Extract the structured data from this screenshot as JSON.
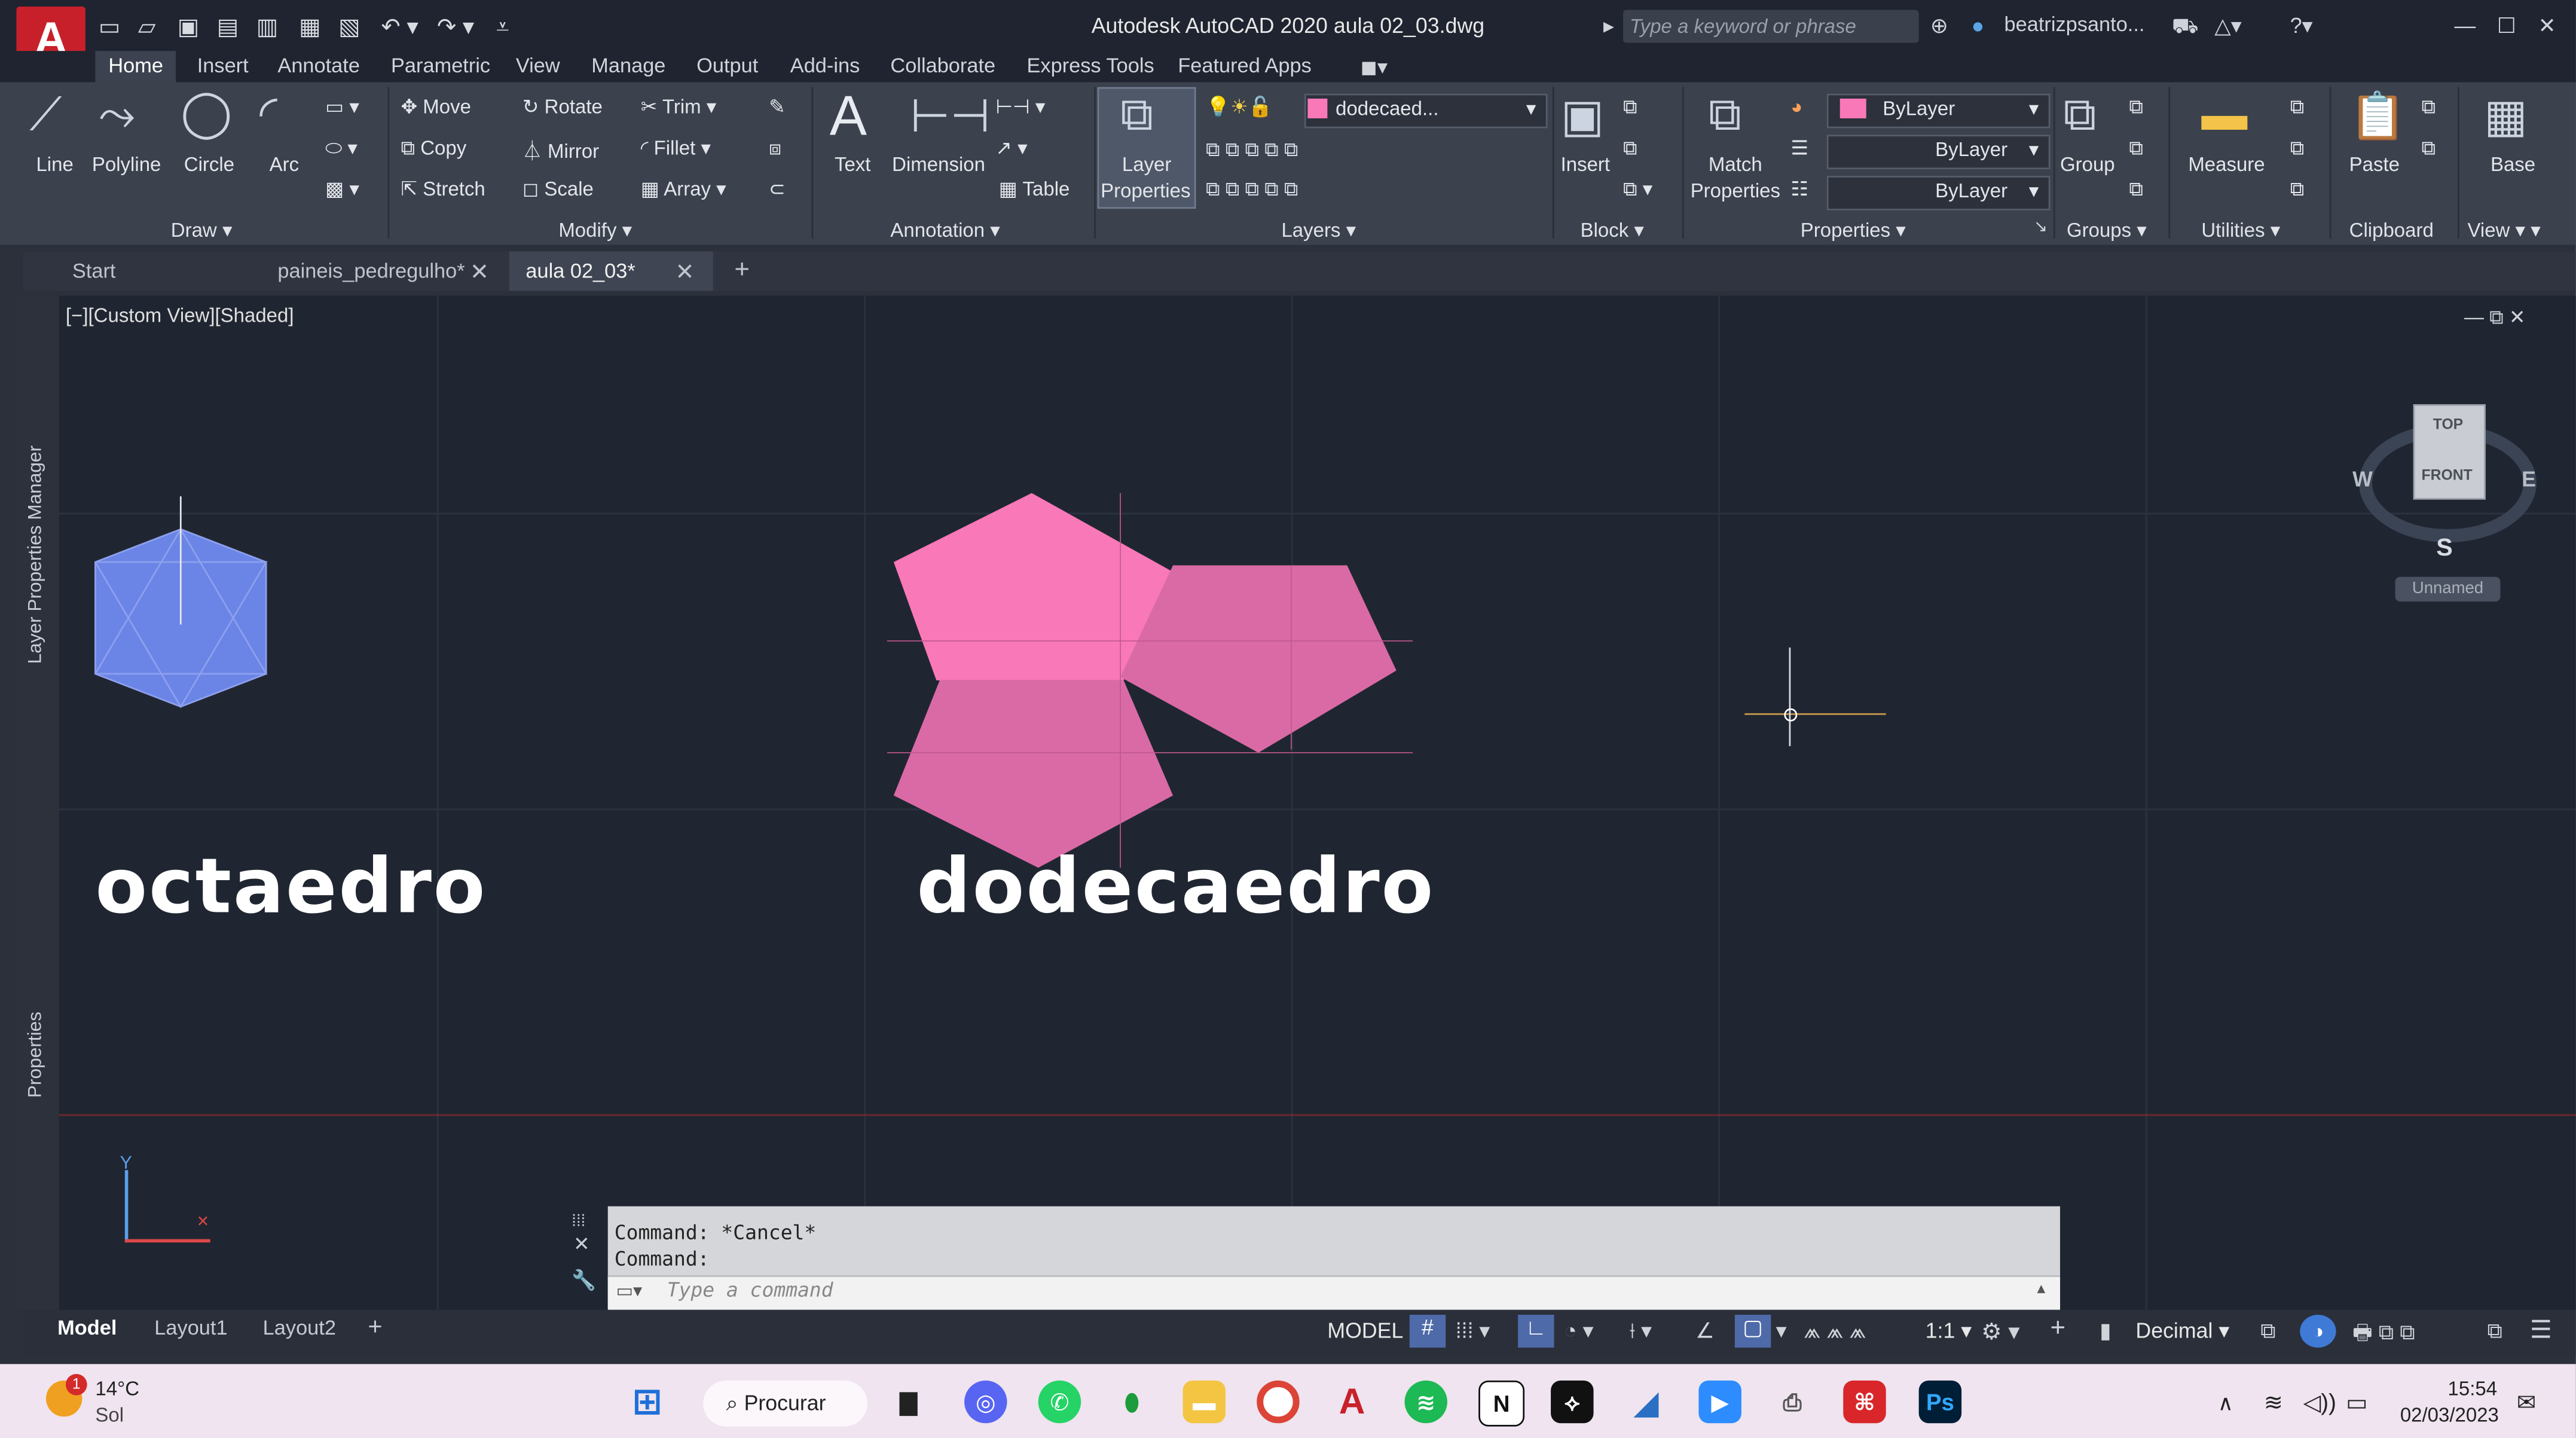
{
  "app": {
    "logo_letter": "A",
    "title": "Autodesk AutoCAD 2020   aula 02_03.dwg",
    "search_placeholder": "Type a keyword or phrase",
    "user": "beatrizpsanto..."
  },
  "menu_tabs": [
    "Home",
    "Insert",
    "Annotate",
    "Parametric",
    "View",
    "Manage",
    "Output",
    "Add-ins",
    "Collaborate",
    "Express Tools",
    "Featured Apps"
  ],
  "draw_tools": {
    "line": "Line",
    "polyline": "Polyline",
    "circle": "Circle",
    "arc": "Arc"
  },
  "modify_tools": {
    "move": "Move",
    "rotate": "Rotate",
    "trim": "Trim",
    "copy": "Copy",
    "mirror": "Mirror",
    "fillet": "Fillet",
    "stretch": "Stretch",
    "scale": "Scale",
    "array": "Array"
  },
  "annotation_tools": {
    "text": "Text",
    "dimension": "Dimension",
    "table": "Table"
  },
  "layer_tools": {
    "layer_properties_1": "Layer",
    "layer_properties_2": "Properties",
    "current_layer": "dodecaed..."
  },
  "block_tools": {
    "insert": "Insert"
  },
  "property_tools": {
    "match_1": "Match",
    "match_2": "Properties",
    "color": "ByLayer",
    "linetype": "ByLayer",
    "lineweight": "ByLayer"
  },
  "group_tools": {
    "group": "Group"
  },
  "utility_tools": {
    "measure": "Measure"
  },
  "clipboard_tools": {
    "paste": "Paste"
  },
  "view_tools": {
    "base": "Base"
  },
  "panel_titles": {
    "draw": "Draw",
    "modify": "Modify",
    "annotation": "Annotation",
    "layers": "Layers",
    "block": "Block",
    "properties": "Properties",
    "groups": "Groups",
    "utilities": "Utilities",
    "clipboard": "Clipboard",
    "view": "View"
  },
  "doc_tabs": [
    "Start",
    "paineis_pedregulho*",
    "aula 02_03*"
  ],
  "viewport": {
    "label": "[−][Custom View][Shaded]",
    "text_left": "octaedro",
    "text_right": "dodecaedro"
  },
  "viewcube": {
    "top": "TOP",
    "front": "FRONT",
    "west": "W",
    "east": "E",
    "south": "S",
    "ucs": "Unnamed"
  },
  "side_panels": {
    "layer_manager": "Layer Properties Manager",
    "properties": "Properties"
  },
  "command": {
    "line1": "Command: *Cancel*",
    "line2": "Command:",
    "placeholder": "Type a command"
  },
  "layout_tabs": [
    "Model",
    "Layout1",
    "Layout2"
  ],
  "status": {
    "model": "MODEL",
    "scale": "1:1",
    "units": "Decimal"
  },
  "taskbar": {
    "temp": "14°C",
    "weather": "Sol",
    "weather_badge": "1",
    "search": "Procurar",
    "time": "15:54",
    "date": "02/03/2023"
  },
  "colors": {
    "pink": "#f978b8",
    "pink_dark": "#d96aa5",
    "blue": "#6b85e6",
    "ribbon": "#3b414d",
    "viewport": "#202631"
  }
}
